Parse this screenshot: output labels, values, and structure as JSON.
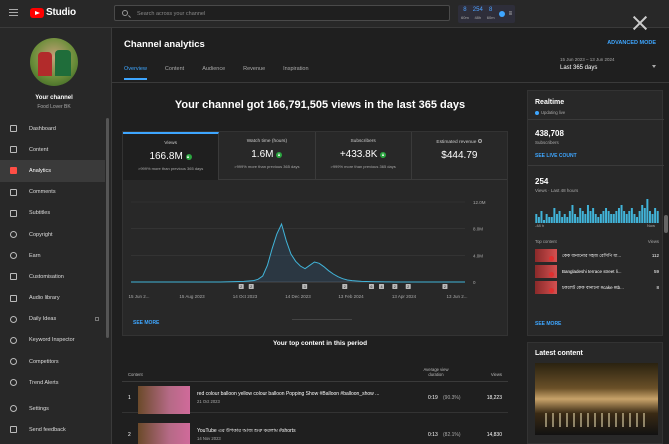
{
  "app": {
    "title": "Studio"
  },
  "search": {
    "placeholder": "Search across your channel"
  },
  "topbar_stats": [
    {
      "value": "8",
      "unit": "60m"
    },
    {
      "value": "254",
      "unit": "48h"
    },
    {
      "value": "8",
      "unit": "60m"
    }
  ],
  "topbar_more": "≡",
  "channel": {
    "label": "Your channel",
    "name": "Food Lover BK"
  },
  "sidebar": {
    "items": [
      {
        "label": "Dashboard",
        "icon": "dashboard-icon"
      },
      {
        "label": "Content",
        "icon": "content-icon"
      },
      {
        "label": "Analytics",
        "icon": "analytics-icon",
        "active": true
      },
      {
        "label": "Comments",
        "icon": "comments-icon"
      },
      {
        "label": "Subtitles",
        "icon": "subtitles-icon"
      },
      {
        "label": "Copyright",
        "icon": "copyright-icon"
      },
      {
        "label": "Earn",
        "icon": "earn-icon"
      },
      {
        "label": "Customisation",
        "icon": "customisation-icon"
      },
      {
        "label": "Audio library",
        "icon": "audio-library-icon"
      },
      {
        "label": "Daily Ideas",
        "icon": "daily-ideas-icon"
      },
      {
        "label": "Keyword Inspector",
        "icon": "keyword-inspector-icon"
      },
      {
        "label": "Competitors",
        "icon": "competitors-icon"
      },
      {
        "label": "Trend Alerts",
        "icon": "trend-alerts-icon"
      }
    ],
    "bottom": [
      {
        "label": "Settings",
        "icon": "gear-icon"
      },
      {
        "label": "Send feedback",
        "icon": "feedback-icon"
      }
    ]
  },
  "header": {
    "title": "Channel analytics",
    "advanced": "ADVANCED MODE",
    "tabs": [
      "Overview",
      "Content",
      "Audience",
      "Revenue",
      "Inspiration"
    ],
    "date_range": "15 Jun 2023 – 13 Jun 2024",
    "period": "Last 365 days"
  },
  "headline": "Your channel got 166,791,505 views in the last 365 days",
  "metrics": [
    {
      "title": "Views",
      "value": "166.8M",
      "sub": ">999% more than previous 365 days"
    },
    {
      "title": "Watch time (hours)",
      "value": "1.6M",
      "sub": ">999% more than previous 365 days"
    },
    {
      "title": "Subscribers",
      "value": "+433.8K",
      "sub": ">999% more than previous 365 days"
    },
    {
      "title": "Estimated revenue",
      "value": "$444.79",
      "sub": ""
    }
  ],
  "chart_data": {
    "type": "line",
    "x_ticks": [
      "15 Jun 2...",
      "15 Aug 2023",
      "14 Oct 2023",
      "14 Dec 2023",
      "13 Feb 2024",
      "13 Apr 2024",
      "13 Jun 2..."
    ],
    "y_ticks": [
      "0",
      "4.0M",
      "8.0M",
      "12.0M"
    ],
    "ylim": [
      0,
      12000000
    ],
    "markers": [
      "2",
      "2",
      "3",
      "2",
      "6",
      "4",
      "2",
      "2",
      "2"
    ],
    "series": [
      {
        "values": [
          0,
          0,
          0,
          0,
          0,
          0,
          0,
          0,
          0,
          0,
          0,
          0,
          0,
          0,
          0,
          0,
          0,
          0,
          0,
          0,
          20000,
          30000,
          50000,
          80000,
          100000,
          150000,
          200000,
          400000,
          900000,
          2500000,
          5000000,
          7200000,
          8700000,
          6200000,
          4200000,
          3100000,
          2400000,
          2000000,
          2500000,
          3000000,
          2800000,
          2300000,
          1700000,
          1200000,
          800000,
          500000,
          300000,
          200000,
          150000,
          100000,
          80000,
          60000,
          40000,
          30000,
          20000,
          10000,
          5000,
          0,
          0,
          0,
          0,
          0,
          0,
          0,
          0,
          0,
          0,
          0,
          0,
          0,
          0,
          0
        ]
      }
    ]
  },
  "see_more": "SEE MORE",
  "top_content": {
    "title": "Your top content in this period",
    "headers": {
      "content": "Content",
      "avd": "Average view duration",
      "views": "Views"
    },
    "rows": [
      {
        "rank": "1",
        "title": "red colour balloon yellow colour balloon Popping Show #Balloon #balloon_show ...",
        "date": "21 Oct 2023",
        "avd": "0:19",
        "pct": "(90.3%)",
        "views": "18,223"
      },
      {
        "rank": "2",
        "title": "YouTube এর উপকার আজ শুরু করলাম #shorts",
        "date": "14 Nov 2023",
        "avd": "0:13",
        "pct": "(82.1%)",
        "views": "14,830"
      }
    ]
  },
  "realtime": {
    "title": "Realtime",
    "updating": "Updating live",
    "subs": "438,708",
    "subs_label": "Subscribers",
    "live_count": "SEE LIVE COUNT",
    "views": "254",
    "views_label": "Views · Last 48 hours",
    "bars": [
      3,
      2,
      4,
      1,
      3,
      2,
      2,
      5,
      3,
      4,
      2,
      3,
      2,
      4,
      6,
      3,
      2,
      5,
      4,
      3,
      6,
      4,
      5,
      3,
      2,
      3,
      4,
      5,
      4,
      3,
      3,
      4,
      5,
      6,
      4,
      3,
      4,
      5,
      3,
      2,
      4,
      6,
      5,
      8,
      4,
      3,
      5,
      4
    ],
    "ax_left": "-48 h",
    "ax_right": "Now",
    "tc_head": "Top content",
    "tc_head_right": "Views",
    "items": [
      {
        "title": "কেক বানানোর সহজ রেসিপি যা...",
        "views": "112"
      },
      {
        "title": "Bangladeshi terrace street li...",
        "views": "59"
      },
      {
        "title": "চকলেট কেক বানানো #cake #tb...",
        "views": "8"
      }
    ],
    "see_more": "SEE MORE"
  },
  "latest": {
    "title": "Latest content"
  }
}
